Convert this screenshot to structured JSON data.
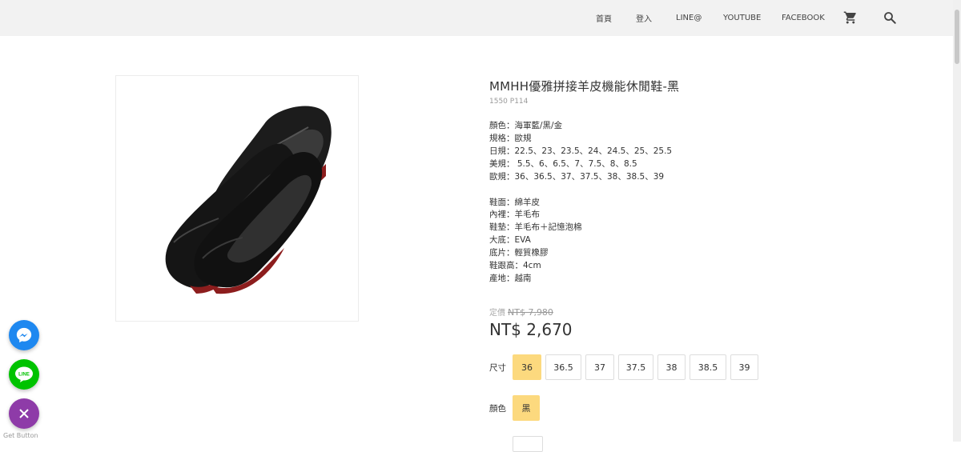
{
  "nav": {
    "items": [
      "首頁",
      "登入",
      "LINE@",
      "YOUTUBE",
      "FACEBOOK"
    ],
    "cart_icon": "cart-icon",
    "search_icon": "search-icon"
  },
  "product": {
    "title": "MMHH優雅拼接羊皮機能休閒鞋-黑",
    "sku": "1550 P114",
    "specs_group1": [
      "顏色：海軍藍/黑/金",
      "規格：歐規",
      "日規：22.5、23、23.5、24、24.5、25、25.5",
      "美規： 5.5、6、6.5、7、7.5、8、8.5",
      "歐規：36、36.5、37、37.5、38、38.5、39"
    ],
    "specs_group2": [
      "鞋面：綿羊皮",
      "內裡：羊毛布",
      "鞋墊：羊毛布＋記憶泡棉",
      "大底：EVA",
      "底片：輕質橡膠",
      "鞋跟高：4cm",
      "產地：越南"
    ],
    "original_price_label": "定價",
    "original_price": "NT$ 7,980",
    "sale_price": "NT$ 2,670",
    "size_label": "尺寸",
    "sizes": [
      "36",
      "36.5",
      "37",
      "37.5",
      "38",
      "38.5",
      "39"
    ],
    "selected_size": "36",
    "color_label": "顏色",
    "colors": [
      "黑"
    ],
    "selected_color": "黑"
  },
  "floating": {
    "buttons": [
      "messenger-icon",
      "line-icon",
      "close-icon"
    ],
    "get_button_text": "Get Button"
  },
  "colors": {
    "accent": "#fcd97e",
    "topbar": "#f2f2f2",
    "messenger": "#1e88f0",
    "line": "#00c300",
    "close": "#8e3ba8"
  }
}
